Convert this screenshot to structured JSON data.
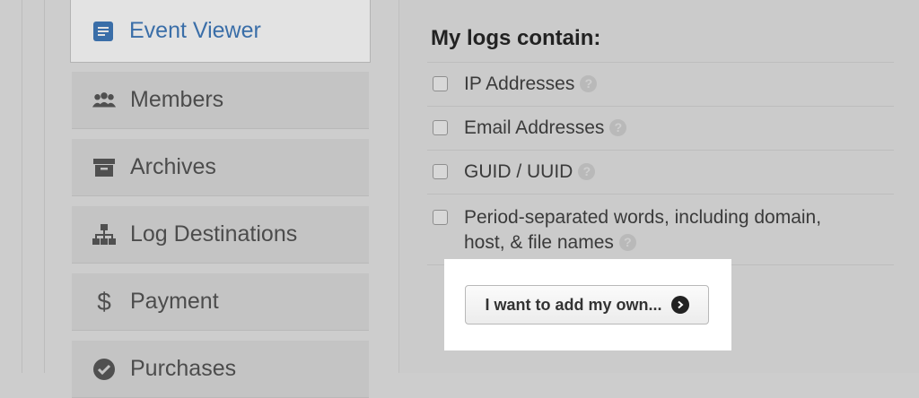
{
  "sidebar": {
    "items": [
      {
        "label": "Event Viewer",
        "icon": "list-doc-icon",
        "active": true
      },
      {
        "label": "Members",
        "icon": "users-icon"
      },
      {
        "label": "Archives",
        "icon": "archive-box-icon"
      },
      {
        "label": "Log Destinations",
        "icon": "sitemap-icon"
      },
      {
        "label": "Payment",
        "icon": "dollar-icon"
      },
      {
        "label": "Purchases",
        "icon": "check-circle-icon"
      }
    ]
  },
  "main": {
    "heading": "My logs contain:",
    "options": [
      {
        "label": "IP Addresses",
        "checked": false
      },
      {
        "label": "Email Addresses",
        "checked": false
      },
      {
        "label": "GUID / UUID",
        "checked": false
      },
      {
        "label_line1": "Period-separated words, including domain,",
        "label_line2": "host, & file names",
        "checked": false
      }
    ],
    "help_glyph": "?",
    "add_own_button": "I want to add my own..."
  },
  "colors": {
    "accent": "#3a6ea8",
    "highlight": "#ffffff",
    "background": "#cdcdcd"
  }
}
